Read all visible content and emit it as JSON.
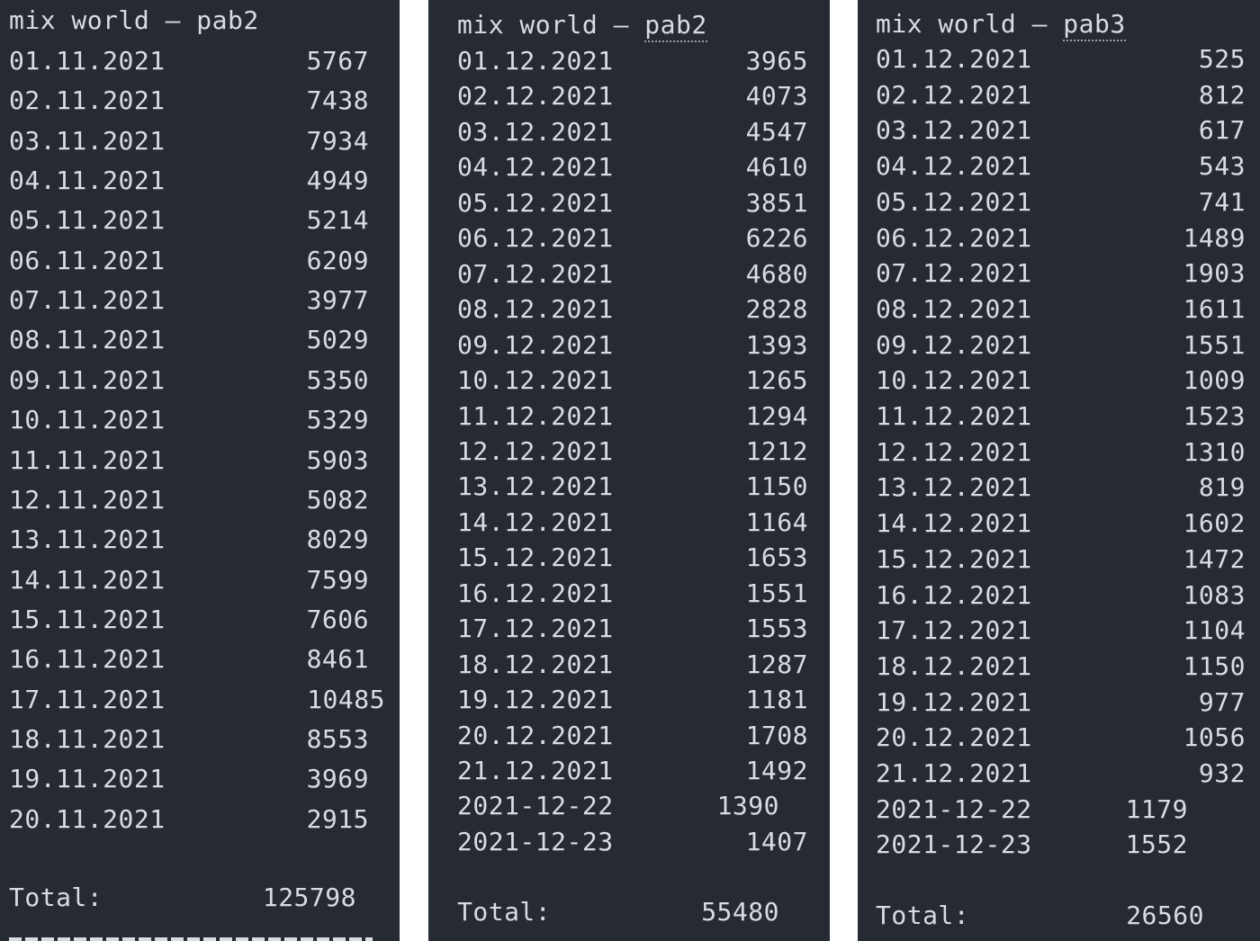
{
  "panels": [
    {
      "title_prefix": "mix world – ",
      "title_name": "pab2",
      "rows": [
        {
          "date": "01.11.2021",
          "value": "5767"
        },
        {
          "date": "02.11.2021",
          "value": "7438"
        },
        {
          "date": "03.11.2021",
          "value": "7934"
        },
        {
          "date": "04.11.2021",
          "value": "4949"
        },
        {
          "date": "05.11.2021",
          "value": "5214"
        },
        {
          "date": "06.11.2021",
          "value": "6209"
        },
        {
          "date": "07.11.2021",
          "value": "3977"
        },
        {
          "date": "08.11.2021",
          "value": "5029"
        },
        {
          "date": "09.11.2021",
          "value": "5350"
        },
        {
          "date": "10.11.2021",
          "value": "5329"
        },
        {
          "date": "11.11.2021",
          "value": "5903"
        },
        {
          "date": "12.11.2021",
          "value": "5082"
        },
        {
          "date": "13.11.2021",
          "value": "8029"
        },
        {
          "date": "14.11.2021",
          "value": "7599"
        },
        {
          "date": "15.11.2021",
          "value": "7606"
        },
        {
          "date": "16.11.2021",
          "value": "8461"
        },
        {
          "date": "17.11.2021",
          "value": "10485"
        },
        {
          "date": "18.11.2021",
          "value": "8553"
        },
        {
          "date": "19.11.2021",
          "value": "3969"
        },
        {
          "date": "20.11.2021",
          "value": "2915"
        }
      ],
      "total_label": "Total:",
      "total_value": "125798"
    },
    {
      "title_prefix": "mix world – ",
      "title_name": "pab2",
      "rows": [
        {
          "date": "01.12.2021",
          "value": "3965"
        },
        {
          "date": "02.12.2021",
          "value": "4073"
        },
        {
          "date": "03.12.2021",
          "value": "4547"
        },
        {
          "date": "04.12.2021",
          "value": "4610"
        },
        {
          "date": "05.12.2021",
          "value": "3851"
        },
        {
          "date": "06.12.2021",
          "value": "6226"
        },
        {
          "date": "07.12.2021",
          "value": "4680"
        },
        {
          "date": "08.12.2021",
          "value": "2828"
        },
        {
          "date": "09.12.2021",
          "value": "1393"
        },
        {
          "date": "10.12.2021",
          "value": "1265"
        },
        {
          "date": "11.12.2021",
          "value": "1294"
        },
        {
          "date": "12.12.2021",
          "value": "1212"
        },
        {
          "date": "13.12.2021",
          "value": "1150"
        },
        {
          "date": "14.12.2021",
          "value": "1164"
        },
        {
          "date": "15.12.2021",
          "value": "1653"
        },
        {
          "date": "16.12.2021",
          "value": "1551"
        },
        {
          "date": "17.12.2021",
          "value": "1553"
        },
        {
          "date": "18.12.2021",
          "value": "1287"
        },
        {
          "date": "19.12.2021",
          "value": "1181"
        },
        {
          "date": "20.12.2021",
          "value": "1708"
        },
        {
          "date": "21.12.2021",
          "value": "1492"
        },
        {
          "date": "2021-12-22",
          "value": "1390"
        },
        {
          "date": "2021-12-23",
          "value": "1407"
        }
      ],
      "total_label": "Total:",
      "total_value": "55480"
    },
    {
      "title_prefix": "mix world – ",
      "title_name": "pab3",
      "rows": [
        {
          "date": "01.12.2021",
          "value": "525"
        },
        {
          "date": "02.12.2021",
          "value": "812"
        },
        {
          "date": "03.12.2021",
          "value": "617"
        },
        {
          "date": "04.12.2021",
          "value": "543"
        },
        {
          "date": "05.12.2021",
          "value": "741"
        },
        {
          "date": "06.12.2021",
          "value": "1489"
        },
        {
          "date": "07.12.2021",
          "value": "1903"
        },
        {
          "date": "08.12.2021",
          "value": "1611"
        },
        {
          "date": "09.12.2021",
          "value": "1551"
        },
        {
          "date": "10.12.2021",
          "value": "1009"
        },
        {
          "date": "11.12.2021",
          "value": "1523"
        },
        {
          "date": "12.12.2021",
          "value": "1310"
        },
        {
          "date": "13.12.2021",
          "value": "819"
        },
        {
          "date": "14.12.2021",
          "value": "1602"
        },
        {
          "date": "15.12.2021",
          "value": "1472"
        },
        {
          "date": "16.12.2021",
          "value": "1083"
        },
        {
          "date": "17.12.2021",
          "value": "1104"
        },
        {
          "date": "18.12.2021",
          "value": "1150"
        },
        {
          "date": "19.12.2021",
          "value": "977"
        },
        {
          "date": "20.12.2021",
          "value": "1056"
        },
        {
          "date": "21.12.2021",
          "value": "932"
        },
        {
          "date": "2021-12-22",
          "value": "1179"
        },
        {
          "date": "2021-12-23",
          "value": "1552"
        }
      ],
      "total_label": "Total:",
      "total_value": "26560"
    }
  ]
}
